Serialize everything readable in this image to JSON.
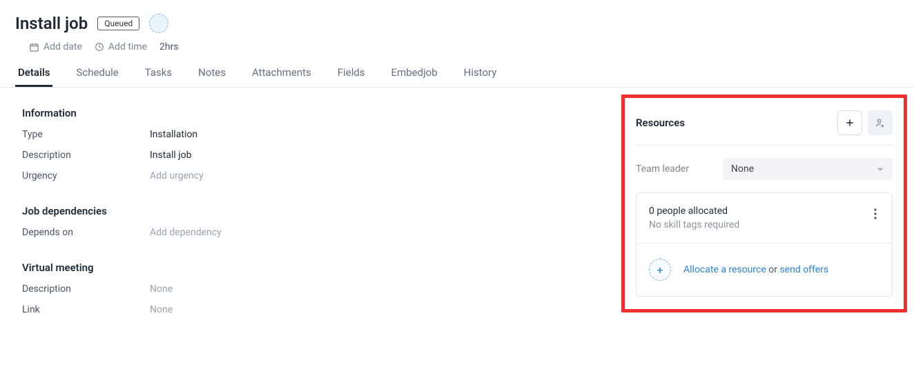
{
  "header": {
    "title": "Install job",
    "status": "Queued"
  },
  "meta": {
    "add_date": "Add date",
    "add_time": "Add time",
    "duration": "2hrs"
  },
  "tabs": {
    "details": "Details",
    "schedule": "Schedule",
    "tasks": "Tasks",
    "notes": "Notes",
    "attachments": "Attachments",
    "fields": "Fields",
    "embedjob": "Embedjob",
    "history": "History"
  },
  "information": {
    "heading": "Information",
    "type_label": "Type",
    "type_value": "Installation",
    "description_label": "Description",
    "description_value": "Install job",
    "urgency_label": "Urgency",
    "urgency_placeholder": "Add urgency"
  },
  "dependencies": {
    "heading": "Job dependencies",
    "depends_on_label": "Depends on",
    "depends_on_placeholder": "Add dependency"
  },
  "virtual_meeting": {
    "heading": "Virtual meeting",
    "description_label": "Description",
    "description_value": "None",
    "link_label": "Link",
    "link_value": "None"
  },
  "resources": {
    "heading": "Resources",
    "team_leader_label": "Team leader",
    "team_leader_value": "None",
    "allocated_count": "0 people allocated",
    "skill_tags": "No skill tags required",
    "allocate_link": "Allocate a resource",
    "or_text": " or ",
    "send_offers_link": "send offers"
  }
}
